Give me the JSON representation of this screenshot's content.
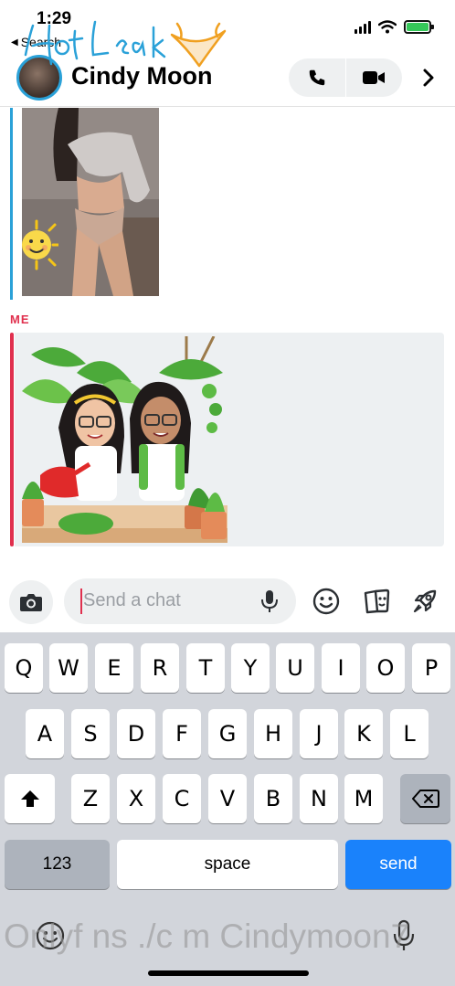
{
  "status_bar": {
    "time": "1:29",
    "back_label": "Search",
    "battery_color": "#35c759"
  },
  "watermark_logo": {
    "text": "Hot Leak",
    "color": "#2aa1d8",
    "accent": "#f0a020"
  },
  "header": {
    "contact_name": "Cindy Moon",
    "call_icon": "phone-icon",
    "video_icon": "video-camera-icon",
    "next_icon": "chevron-right-icon"
  },
  "messages": {
    "sender_label": "ME",
    "their_color": "#2aa1d8",
    "my_color": "#e0304e",
    "sticker_desc": "bitmoji"
  },
  "chat_input": {
    "placeholder": "Send a chat",
    "camera_icon": "camera-icon",
    "mic_icon": "microphone-icon",
    "emoji_icon": "smiley-icon",
    "sticker_icon": "sticker-icon",
    "rocket_icon": "rocket-icon"
  },
  "keyboard": {
    "row1": [
      "Q",
      "W",
      "E",
      "R",
      "T",
      "Y",
      "U",
      "I",
      "O",
      "P"
    ],
    "row2": [
      "A",
      "S",
      "D",
      "F",
      "G",
      "H",
      "J",
      "K",
      "L"
    ],
    "row3": [
      "Z",
      "X",
      "C",
      "V",
      "B",
      "N",
      "M"
    ],
    "numbers_label": "123",
    "space_label": "space",
    "send_label": "send",
    "send_color": "#1a82fb"
  },
  "overlay_text": "Onlyf ns ./c m Cindymoon7"
}
